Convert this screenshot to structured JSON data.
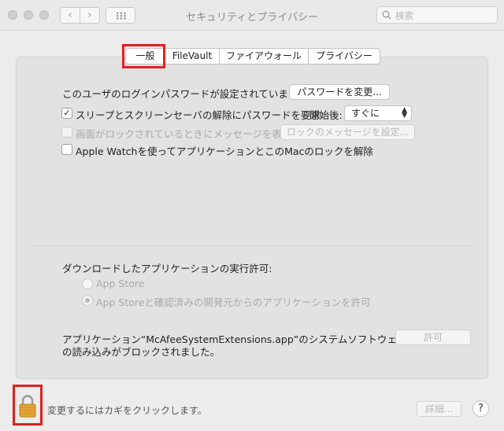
{
  "window": {
    "title": "セキュリティとプライバシー"
  },
  "toolbar": {
    "back_symbol": "‹",
    "forward_symbol": "›",
    "search_placeholder": "検索"
  },
  "tabs": [
    {
      "label": "一般",
      "selected": true
    },
    {
      "label": "FileVault",
      "selected": false
    },
    {
      "label": "ファイアウォール",
      "selected": false
    },
    {
      "label": "プライバシー",
      "selected": false
    }
  ],
  "general": {
    "password_text": "このユーザのログインパスワードが設定されています",
    "change_password_button": "パスワードを変更...",
    "require_password": {
      "label": "スリープとスクリーンセーバの解除にパスワードを要求",
      "checked": true,
      "delay_label": "開始後:",
      "delay_value": "すぐに"
    },
    "lock_message": {
      "label": "画面がロックされているときにメッセージを表示",
      "checked": false,
      "disabled": true,
      "button": "ロックのメッセージを設定..."
    },
    "apple_watch": {
      "label": "Apple Watchを使ってアプリケーションとこのMacのロックを解除",
      "checked": false
    }
  },
  "downloads": {
    "heading": "ダウンロードしたアプリケーションの実行許可:",
    "options": [
      {
        "label": "App Store",
        "selected": false
      },
      {
        "label": "App Storeと確認済みの開発元からのアプリケーションを許可",
        "selected": true
      }
    ]
  },
  "blocked": {
    "line1": "アプリケーション“McAfeeSystemExtensions.app”のシステムソフトウェア",
    "line2": "の読み込みがブロックされました。",
    "allow_button": "許可"
  },
  "footer": {
    "lock_text": "変更するにはカギをクリックします。",
    "advanced_button": "詳細...",
    "help_symbol": "?"
  },
  "colors": {
    "highlight": "#e0211d",
    "lock": "#e5a437"
  }
}
